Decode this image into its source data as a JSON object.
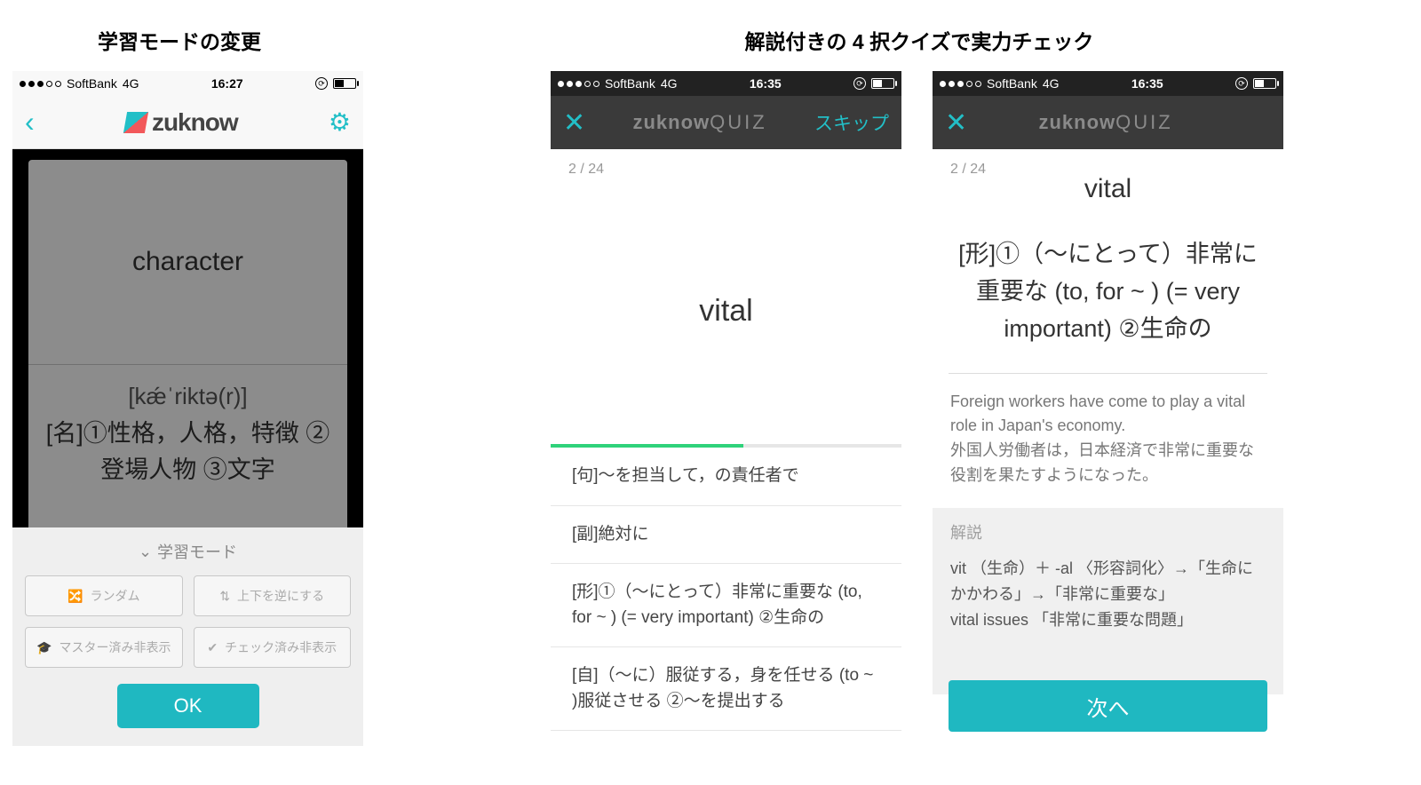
{
  "captions": {
    "left": "学習モードの変更",
    "right": "解説付きの 4 択クイズで実力チェック"
  },
  "statusbar": {
    "carrier": "SoftBank",
    "net": "4G",
    "time1": "16:27",
    "time2": "16:35",
    "time3": "16:35"
  },
  "app": {
    "name": "zuknow",
    "quiz_suffix": "QUIZ"
  },
  "phone1": {
    "card_front": "character",
    "card_pron": "[kǽˈriktə(r)]",
    "card_meaning": "[名]①性格，人格，特徴 ②登場人物 ③文字",
    "sheet_title": "学習モード",
    "opt_random": "ランダム",
    "opt_flip": "上下を逆にする",
    "opt_master": "マスター済み非表示",
    "opt_check": "チェック済み非表示",
    "ok": "OK"
  },
  "quiz": {
    "skip": "スキップ",
    "progress": "2 / 24",
    "word": "vital",
    "choices": [
      "[句]～を担当して，の責任者で",
      "[副]絶対に",
      "[形]①（～にとって）非常に重要な (to, for ~ ) (= very important) ②生命の",
      "[自]（～に）服従する，身を任せる (to ~ )服従させる ②～を提出する"
    ],
    "definition": "[形]①（～にとって）非常に重要な (to, for ~ ) (= very important) ②生命の",
    "example_en": "Foreign workers have come to play a vital role in Japan's economy.",
    "example_jp": "外国人労働者は，日本経済で非常に重要な役割を果たすようになった。",
    "explain_label": "解説",
    "explain_body": "vit （生命）＋ -al 〈形容詞化〉→「生命にかかわる」→「非常に重要な」\nvital issues 「非常に重要な問題」",
    "next": "次へ"
  }
}
